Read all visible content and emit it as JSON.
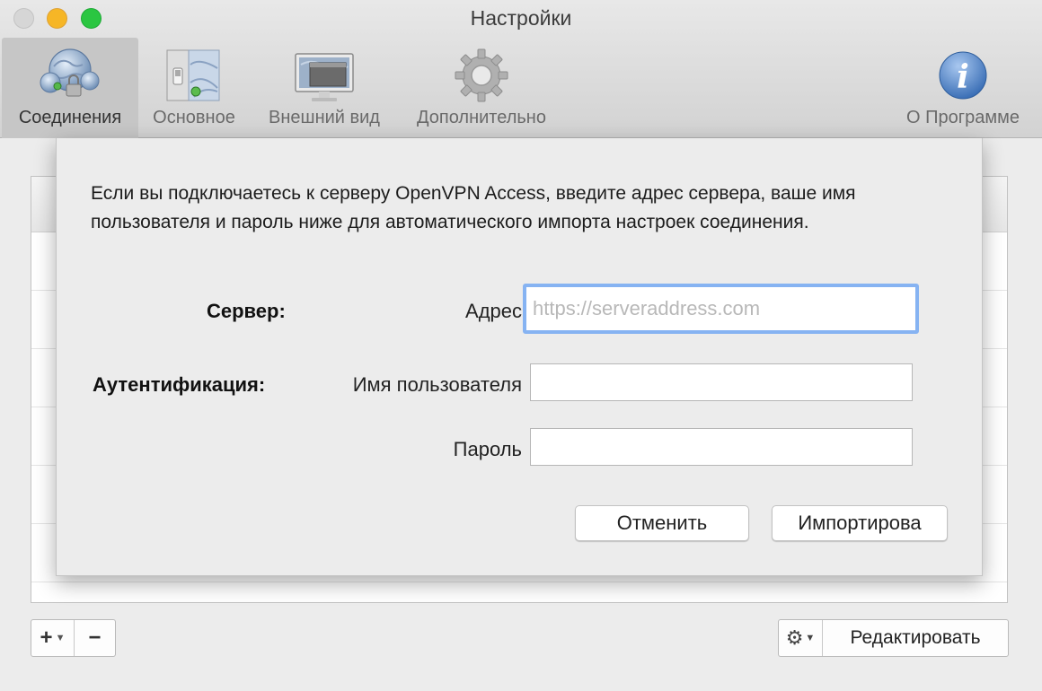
{
  "window": {
    "title": "Настройки"
  },
  "toolbar": {
    "items": [
      {
        "label": "Соединения",
        "icon": "globe-connections-icon",
        "selected": true
      },
      {
        "label": "Основное",
        "icon": "switch-panel-icon",
        "selected": false
      },
      {
        "label": "Внешний вид",
        "icon": "monitor-icon",
        "selected": false
      },
      {
        "label": "Дополнительно",
        "icon": "gear-icon",
        "selected": false
      },
      {
        "label": "О Программе",
        "icon": "info-icon",
        "selected": false
      }
    ]
  },
  "sheet": {
    "description": "Если вы подключаетесь к серверу OpenVPN Access, введите адрес сервера, ваше имя пользователя и пароль ниже для автоматического импорта настроек соединения.",
    "server_label": "Сервер:",
    "address_label": "Адрес",
    "address_placeholder": "https://serveraddress.com",
    "address_value": "",
    "auth_label": "Аутентификация:",
    "username_label": "Имя пользователя",
    "username_value": "",
    "password_label": "Пароль",
    "password_value": "",
    "cancel_label": "Отменить",
    "import_label": "Импортирова"
  },
  "bottom_bar": {
    "add_label": "+",
    "remove_label": "−",
    "edit_label": "Редактировать"
  },
  "colors": {
    "focus_ring": "#86b3f2",
    "close_button": "#d6d6d6",
    "minimize_button": "#f6b626",
    "zoom_button": "#2ac641"
  }
}
